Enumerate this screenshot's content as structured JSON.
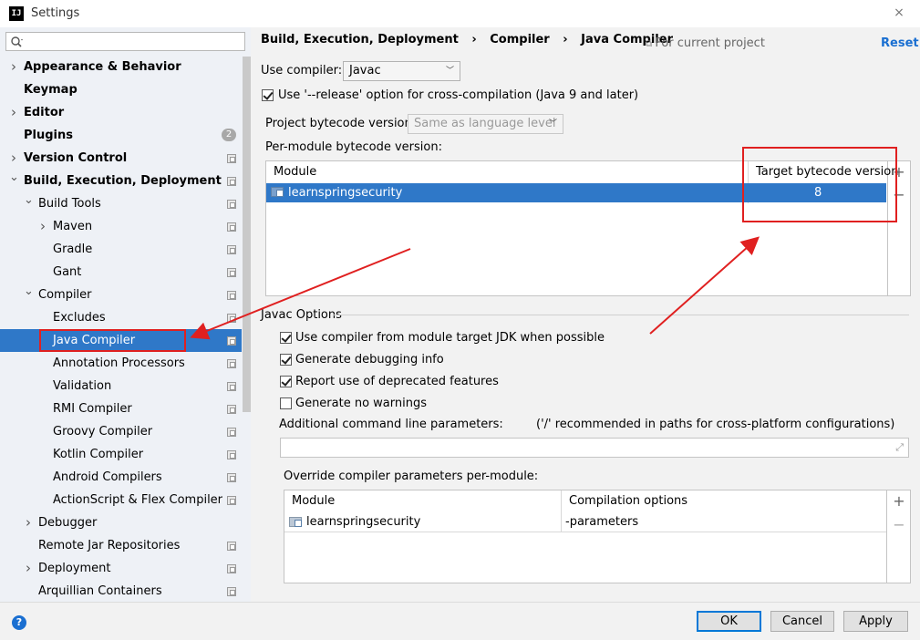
{
  "window": {
    "title": "Settings",
    "app_icon": "intellij-icon",
    "close_label": "×"
  },
  "sidebar": {
    "search": {
      "placeholder": ""
    },
    "items": [
      {
        "label": "Appearance & Behavior",
        "bold": true,
        "arrow": "collapsed"
      },
      {
        "label": "Keymap",
        "bold": true
      },
      {
        "label": "Editor",
        "bold": true,
        "arrow": "collapsed"
      },
      {
        "label": "Plugins",
        "bold": true,
        "badge": "2"
      },
      {
        "label": "Version Control",
        "bold": true,
        "arrow": "collapsed"
      },
      {
        "label": "Build, Execution, Deployment",
        "bold": true,
        "arrow": "expanded"
      },
      {
        "label": "Build Tools",
        "arrow": "expanded"
      },
      {
        "label": "Maven",
        "arrow": "collapsed"
      },
      {
        "label": "Gradle"
      },
      {
        "label": "Gant"
      },
      {
        "label": "Compiler",
        "arrow": "expanded"
      },
      {
        "label": "Excludes"
      },
      {
        "label": "Java Compiler",
        "selected": true
      },
      {
        "label": "Annotation Processors"
      },
      {
        "label": "Validation"
      },
      {
        "label": "RMI Compiler"
      },
      {
        "label": "Groovy Compiler"
      },
      {
        "label": "Kotlin Compiler"
      },
      {
        "label": "Android Compilers"
      },
      {
        "label": "ActionScript & Flex Compiler"
      },
      {
        "label": "Debugger",
        "arrow": "collapsed"
      },
      {
        "label": "Remote Jar Repositories"
      },
      {
        "label": "Deployment",
        "arrow": "collapsed"
      },
      {
        "label": "Arquillian Containers"
      }
    ]
  },
  "header": {
    "breadcrumb": [
      "Build, Execution, Deployment",
      "Compiler",
      "Java Compiler"
    ],
    "separator": "›",
    "for_project": "For current project",
    "reset": "Reset"
  },
  "form": {
    "use_compiler_label": "Use compiler:",
    "use_compiler_value": "Javac",
    "release_option_label": "Use '--release' option for cross-compilation (Java 9 and later)",
    "release_option_checked": true,
    "project_bytecode_label": "Project bytecode version:",
    "project_bytecode_value": "Same as language level",
    "per_module_label": "Per-module bytecode version:"
  },
  "bytecode_table": {
    "headers": [
      "Module",
      "Target bytecode version"
    ],
    "rows": [
      {
        "module": "learnspringsecurity",
        "version": "8",
        "selected": true
      }
    ],
    "add": "+",
    "remove": "−"
  },
  "javac_options": {
    "title": "Javac Options",
    "checkboxes": [
      {
        "label": "Use compiler from module target JDK when possible",
        "checked": true
      },
      {
        "label": "Generate debugging info",
        "checked": true
      },
      {
        "label": "Report use of deprecated features",
        "checked": true
      },
      {
        "label": "Generate no warnings",
        "checked": false
      }
    ],
    "additional_params_label": "Additional command line parameters:",
    "additional_params_hint": "('/' recommended in paths for cross-platform configurations)",
    "additional_params_value": "",
    "override_label": "Override compiler parameters per-module:"
  },
  "override_table": {
    "headers": [
      "Module",
      "Compilation options"
    ],
    "rows": [
      {
        "module": "learnspringsecurity",
        "options": "-parameters"
      }
    ],
    "add": "+",
    "remove": "−"
  },
  "footer": {
    "help": "?",
    "ok": "OK",
    "cancel": "Cancel",
    "apply": "Apply"
  },
  "colors": {
    "selection": "#2f78c8",
    "annotation": "#e02020",
    "link": "#1a6fd1"
  }
}
